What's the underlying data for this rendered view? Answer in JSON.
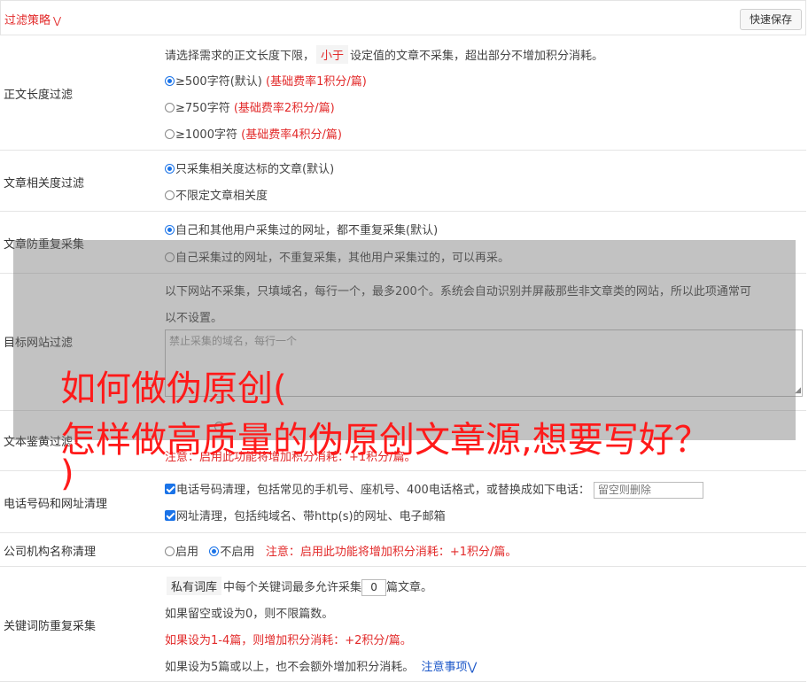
{
  "header": {
    "title": "过滤策略",
    "title_icon": "chevron-down-double-icon",
    "save_label": "快速保存"
  },
  "length_filter": {
    "label": "正文长度过滤",
    "desc_prefix": "请选择需求的正文长度下限，",
    "desc_tag": "小于",
    "desc_suffix": "设定值的文章不采集，超出部分不增加积分消耗。",
    "options": [
      {
        "label": "≥500字符(默认)",
        "note": "(基础费率1积分/篇)",
        "selected": true
      },
      {
        "label": "≥750字符",
        "note": "(基础费率2积分/篇)",
        "selected": false
      },
      {
        "label": "≥1000字符",
        "note": "(基础费率4积分/篇)",
        "selected": false
      }
    ]
  },
  "relevance_filter": {
    "label": "文章相关度过滤",
    "options": [
      {
        "label": "只采集相关度达标的文章(默认)",
        "selected": true
      },
      {
        "label": "不限定文章相关度",
        "selected": false
      }
    ]
  },
  "dup_filter": {
    "label": "文章防重复采集",
    "options": [
      {
        "label": "自己和其他用户采集过的网址，都不重复采集(默认)",
        "selected": true
      },
      {
        "label": "自己采集过的网址，不重复采集，其他用户采集过的，可以再采。",
        "selected": false
      }
    ]
  },
  "site_filter": {
    "label": "目标网站过滤",
    "desc_line1": "以下网站不采集，只填域名，每行一个，最多200个。系统会自动识别并屏蔽那些非文章类的网站，所以此项通常可",
    "desc_line2": "以不设置。",
    "placeholder": "禁止采集的域名，每行一个"
  },
  "identify": {
    "label": "文本鉴黄过滤",
    "note": "注意：启用此功能将增加积分消耗：+1积分/篇。"
  },
  "phone_clean": {
    "label": "电话号码和网址清理",
    "phone_option": "电话号码清理，包括常见的手机号、座机号、400电话格式，或替换成如下电话：",
    "phone_placeholder": "留空则删除",
    "url_option": "网址清理，包括纯域名、带http(s)的网址、电子邮箱"
  },
  "org_clean": {
    "label": "公司机构名称清理",
    "enable_label": "启用",
    "disable_label": "不启用",
    "enable_selected": false,
    "note": "注意：启用此功能将增加积分消耗：+1积分/篇。"
  },
  "keyword_dup": {
    "label": "关键词防重复采集",
    "tag": "私有词库",
    "line1_middle": "中每个关键词最多允许采集",
    "value": "0",
    "line1_suffix": "篇文章。",
    "line2": "如果留空或设为0，则不限篇数。",
    "line3": "如果设为1-4篇，则增加积分消耗：+2积分/篇。",
    "line4": "如果设为5篇或以上，也不会额外增加积分消耗。",
    "link": "注意事项",
    "link_icon": "chevron-down-double-icon"
  },
  "overlay": {
    "line1": "如何做伪原创(",
    "line2": "怎样做高质量的伪原创文章源,想要写好？",
    "line3": ")"
  }
}
